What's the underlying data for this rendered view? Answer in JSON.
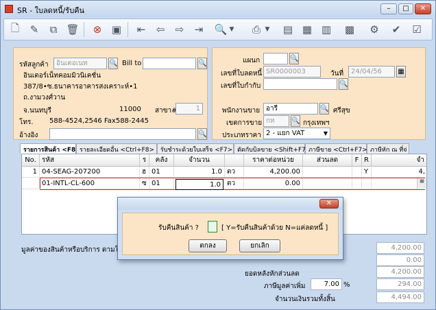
{
  "window": {
    "title": "SR - ใบลดหนี้/รับคืน",
    "minimize": "–",
    "maximize": "□",
    "close": "✕"
  },
  "toolbar": {
    "icons": [
      "new-icon",
      "edit-icon",
      "copy-icon",
      "delete-icon",
      "cancel-icon",
      "save-icon",
      "first-icon",
      "prev-icon",
      "next-icon",
      "last-icon",
      "search-icon",
      "print-icon",
      "export-icon",
      "calc-icon",
      "grid-icon",
      "attach-icon",
      "approve-icon",
      "confirm-icon",
      "ok-icon"
    ]
  },
  "customer": {
    "code_label": "รหัสลูกค้า",
    "code_value": "อินเตอเนท",
    "billto_label": "Bill to",
    "billto_value": "",
    "name": "อินเตอร์เน็ทคอมมิวนิเคชั่น",
    "addr1": "387/8•ซ.ธนาคารอาคารสงเคราะห์•1",
    "addr2": "ถ.งามวงศ์วาน",
    "addr3": "จ.นนทบุรี",
    "zip": "11000",
    "branch_label": "สาขา#",
    "branch_value": "1",
    "tel_label": "โทร.",
    "tel_value": "588-4524,2546  Fax588-2445",
    "ref_label": "อ้างอิง",
    "ref_value": ""
  },
  "doc": {
    "dept_label": "แผนก",
    "dept_value": "",
    "docno_label": "เลขที่ใบลดหนี้",
    "docno_value": "SR0000003",
    "date_label": "วันที่",
    "date_value": "24/04/56",
    "invref_label": "เลขที่ใบกำกับ",
    "invref_value": "",
    "sales_label": "พนักงานขาย",
    "sales_value": "อารี",
    "sales_name": "ศรีสุข",
    "zone_label": "เขตการขาย",
    "zone_value": "กท",
    "zone_name": "กรุงเทพฯ",
    "pricetype_label": "ประเภทราคา",
    "pricetype_value": "2 - แยก VAT"
  },
  "tabs": [
    "รายการสินค้า <F8>",
    "รายละเอียดอื่น  <Ctrl+F8>",
    "รับชำระด้วยใบเสร็จ <F7>",
    "ตัดกับบิลขาย <Shift+F7>",
    "ภาษีขาย <Ctrl+F7>",
    "ภาษีหัก ณ ที่จ่"
  ],
  "grid": {
    "headers": [
      "No.",
      "รหัส",
      "ร",
      "คลัง",
      "จำนวน",
      "",
      "ราคาต่อหน่วย",
      "ส่วนลด",
      "F",
      "R",
      "จำ"
    ],
    "rows": [
      [
        "1",
        "04-SEAG-207200",
        "ฮ",
        "01",
        "1.0",
        "ตว",
        "4,200.00",
        "",
        "",
        "Y",
        "4,"
      ],
      [
        "",
        "01-INTL-CL-600",
        "ซ",
        "01",
        "1.0",
        "ตว",
        "0.00",
        "",
        "",
        "",
        ""
      ]
    ]
  },
  "summary": {
    "goods_label": "มูลค่าของสินค้าหรือบริการ ตามใบกำ",
    "goods_value": "4,200.00",
    "v2": "0.00",
    "after_discount_label": "ยอดหลังหักส่วนลด",
    "after_discount_value": "4,200.00",
    "vat_label": "ภาษีมูลค่าเพิ่ม",
    "vat_rate": "7.00",
    "vat_pct": "%",
    "vat_value": "294.00",
    "total_label": "จำนวนเงินรวมทั้งสิ้น",
    "total_value": "4,494.00"
  },
  "dialog": {
    "close": "✕",
    "question": "รับคืนสินค้า ?",
    "input_value": "",
    "hint": "[ Y=รับคืนสินค้าด้วย   N=แค่ลดหนี้ ]",
    "ok": "ตกลง",
    "cancel": "ยกเลิก"
  }
}
